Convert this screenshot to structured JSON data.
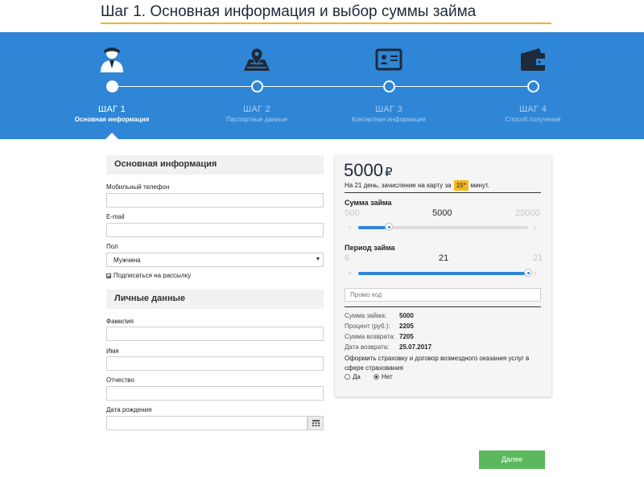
{
  "page": {
    "title": "Шаг 1. Основная информация и выбор суммы займа",
    "accent_color": "#2f86d6",
    "highlight_color": "#f3b324"
  },
  "steps": [
    {
      "label": "ШАГ 1",
      "sub": "Основная информация",
      "icon": "user-icon",
      "active": true
    },
    {
      "label": "ШАГ 2",
      "sub": "Паспортные данные",
      "icon": "map-pin-icon",
      "active": false
    },
    {
      "label": "ШАГ 3",
      "sub": "Контактная информация",
      "icon": "id-card-icon",
      "active": false
    },
    {
      "label": "ШАГ 4",
      "sub": "Способ получения",
      "icon": "wallet-icon",
      "active": false
    }
  ],
  "basic": {
    "section_title": "Основная информация",
    "phone_label": "Мобильный телефон",
    "phone_value": "",
    "email_label": "E-mail",
    "email_value": "",
    "gender_label": "Пол",
    "gender_value": "Мужчина",
    "subscribe_label": "Подписаться на рассылку",
    "subscribe_checked": true
  },
  "personal": {
    "section_title": "Личные данные",
    "lastname_label": "Фамилия",
    "firstname_label": "Имя",
    "patronymic_label": "Отчество",
    "birthdate_label": "Дата рождения"
  },
  "loan": {
    "amount": "5000",
    "currency": "₽",
    "note_before": "На 21 день, зачисление на карту за",
    "note_badge": "15*",
    "note_after": "минут.",
    "amount_slider": {
      "title": "Сумма займа",
      "min": "500",
      "value": "5000",
      "max": "25000",
      "fraction": 0.18
    },
    "period_slider": {
      "title": "Период займа",
      "min": "6",
      "value": "21",
      "max": "21",
      "fraction": 1.0
    },
    "promo_placeholder": "Промо код",
    "summary": [
      {
        "key": "Сумма займа:",
        "value": "5000"
      },
      {
        "key": "Процент (руб.):",
        "value": "2205"
      },
      {
        "key": "Сумма возврата:",
        "value": "7205"
      },
      {
        "key": "Дата возврата:",
        "value": "25.07.2017"
      }
    ],
    "insurance_text": "Оформить страховку и договор возмездного оказания услуг в сфере страхования",
    "insurance_yes": "Да",
    "insurance_no": "Нет",
    "insurance_selected": "no"
  },
  "actions": {
    "next_label": "Далее",
    "next_color": "#5cb85c"
  }
}
